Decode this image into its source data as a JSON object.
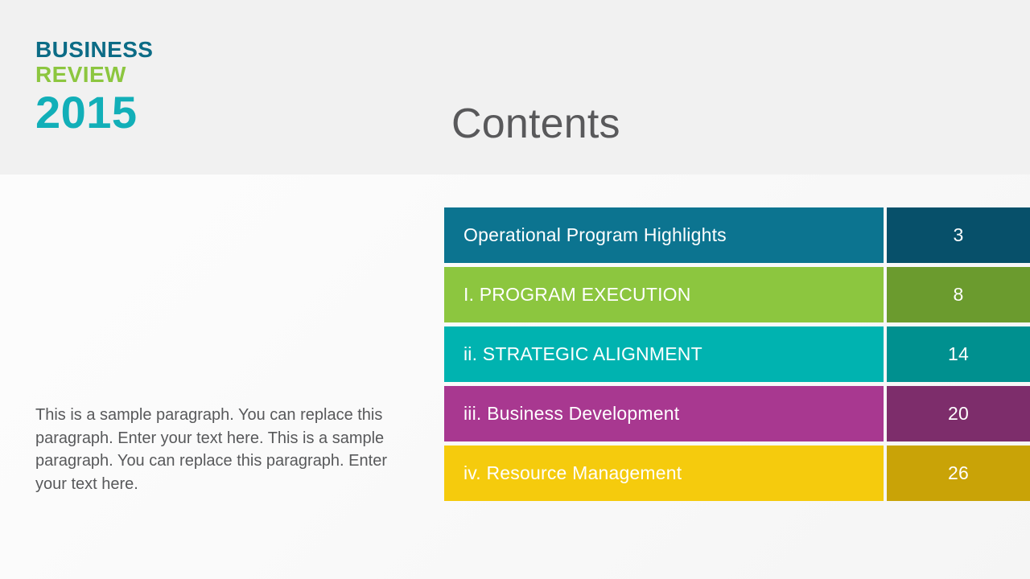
{
  "slide": {
    "background_color": "#f7f7f7",
    "header_band_color": "#f1f1f1"
  },
  "brand": {
    "line1": "BUSINESS",
    "line2": "REVIEW",
    "year": "2015",
    "line1_color": "#0C6C86",
    "line2_color": "#8CC63F",
    "year_color": "#12AFB8"
  },
  "header": {
    "title": "Contents",
    "title_color": "#59595B"
  },
  "body": {
    "paragraph": "This is a sample paragraph. You can replace this paragraph. Enter your text here. This is a sample paragraph. You can replace this paragraph. Enter your text here.",
    "paragraph_color": "#58595B"
  },
  "contents": {
    "rows": [
      {
        "label": "Operational Program Highlights",
        "page": "3",
        "label_color": "#0C7490",
        "page_color": "#07506A"
      },
      {
        "label": "I. PROGRAM EXECUTION",
        "page": "8",
        "label_color": "#8CC63F",
        "page_color": "#6B9B2E"
      },
      {
        "label": "ii. STRATEGIC ALIGNMENT",
        "page": "14",
        "label_color": "#00B3B0",
        "page_color": "#00908F"
      },
      {
        "label": "iii. Business Development",
        "page": "20",
        "label_color": "#A83890",
        "page_color": "#7D2D6B"
      },
      {
        "label": "iv. Resource Management",
        "page": "26",
        "label_color": "#F5CB0D",
        "page_color": "#C9A307"
      }
    ]
  }
}
